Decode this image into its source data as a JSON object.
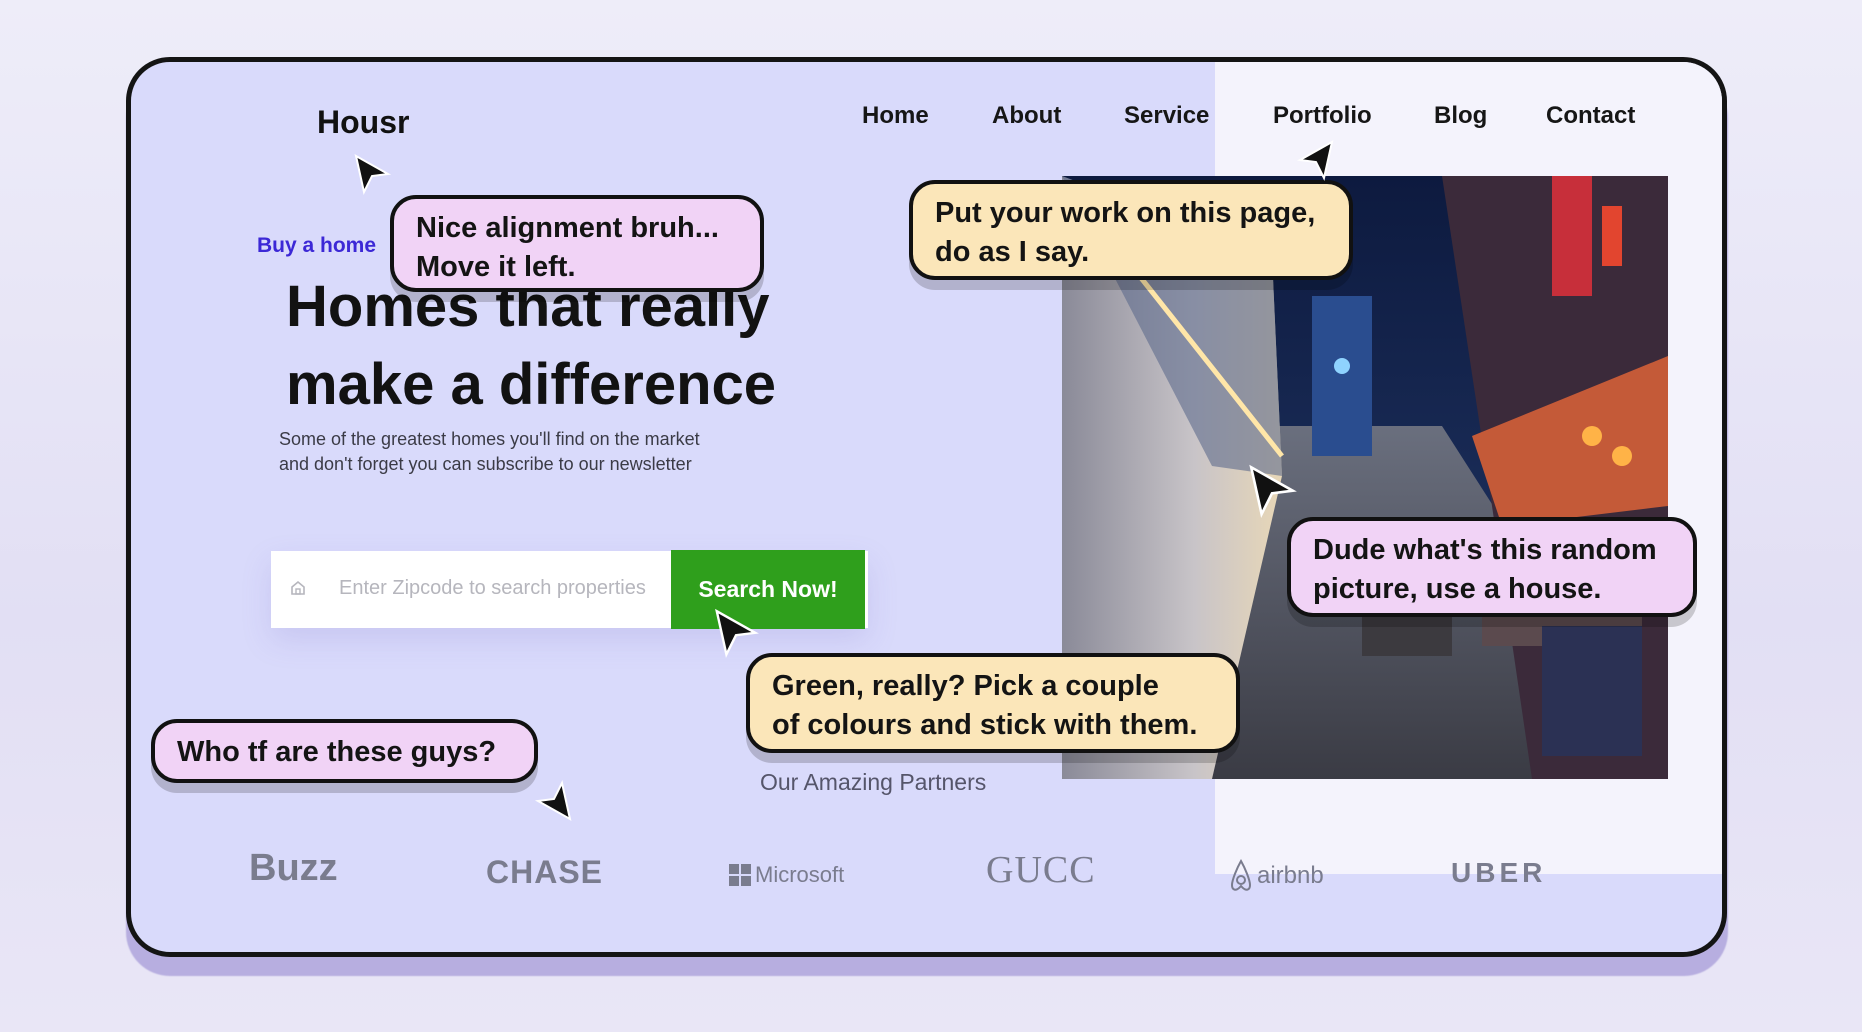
{
  "site": {
    "logo": "Housr",
    "nav": [
      "Home",
      "About",
      "Service",
      "Portfolio",
      "Blog",
      "Contact"
    ]
  },
  "hero": {
    "eyebrow": "Buy a home",
    "headline_line1": "Homes that really",
    "headline_line2": "make a difference",
    "subtext": "Some of the greatest homes you'll find on the market and don't forget you can subscribe to our newsletter"
  },
  "search": {
    "icon": "home-icon",
    "placeholder": "Enter Zipcode to search properties",
    "button_label": "Search Now!",
    "button_color": "#2f9f1c"
  },
  "partners": {
    "title": "Our Amazing Partners",
    "logos": [
      "Buzz",
      "CHASE",
      "Microsoft",
      "GUCC",
      "airbnb",
      "UBER"
    ]
  },
  "annotations": [
    {
      "text_line1": "Nice alignment bruh...",
      "text_line2": "Move it left.",
      "color": "#f1d3f6"
    },
    {
      "text_line1": "Put your work on this page,",
      "text_line2": "do as I say.",
      "color": "#fbe6b9"
    },
    {
      "text_line1": "Dude what's this random",
      "text_line2": "picture, use a house.",
      "color": "#f1d3f6"
    },
    {
      "text_line1": "Green, really? Pick a couple",
      "text_line2": "of colours and stick with them.",
      "color": "#fbe6b9"
    },
    {
      "text_line1": "Who tf are these guys?",
      "color": "#f1d3f6"
    }
  ],
  "colors": {
    "accent": "#3c28d6",
    "page_bg": "#d9dafb",
    "frame_border": "#141414"
  }
}
